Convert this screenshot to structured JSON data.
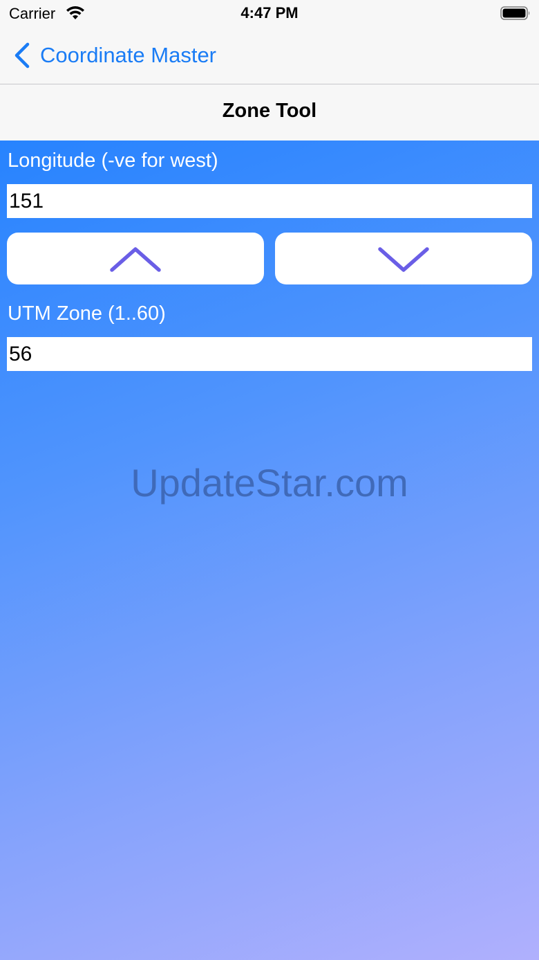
{
  "status_bar": {
    "carrier": "Carrier",
    "time": "4:47 PM"
  },
  "nav": {
    "back_label": "Coordinate Master",
    "title": "Zone Tool"
  },
  "form": {
    "longitude_label": "Longitude (-ve for west)",
    "longitude_value": "151",
    "zone_label": "UTM Zone (1..60)",
    "zone_value": "56"
  },
  "icons": {
    "increment": "chevron-up-icon",
    "decrement": "chevron-down-icon",
    "back": "chevron-left-icon"
  },
  "watermark": "UpdateStar.com",
  "colors": {
    "accent": "#1a7cf5",
    "chevron": "#6a5ee6",
    "gradient_start": "#2783fe",
    "gradient_end": "#b0b0fd"
  }
}
